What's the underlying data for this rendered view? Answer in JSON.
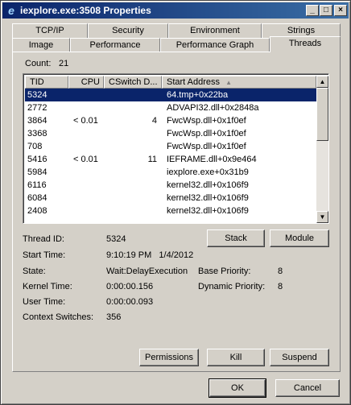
{
  "window": {
    "title": "iexplore.exe:3508 Properties",
    "minimize": "_",
    "maximize": "□",
    "close": "×",
    "icon": "ie-logo-icon",
    "title_bg": "#0a246a"
  },
  "tabs_row1": [
    "TCP/IP",
    "Security",
    "Environment",
    "Strings"
  ],
  "tabs_row2": [
    "Image",
    "Performance",
    "Performance Graph",
    "Threads"
  ],
  "threads": {
    "count_label": "Count:",
    "count_value": "21",
    "columns": [
      "TID",
      "CPU",
      "CSwitch D...",
      "Start Address"
    ],
    "rows": [
      {
        "tid": "5324",
        "cpu": "",
        "cswitch": "",
        "start": "64.tmp+0x22ba"
      },
      {
        "tid": "2772",
        "cpu": "",
        "cswitch": "",
        "start": "ADVAPI32.dll+0x2848a"
      },
      {
        "tid": "3864",
        "cpu": "< 0.01",
        "cswitch": "4",
        "start": "FwcWsp.dll+0x1f0ef"
      },
      {
        "tid": "3368",
        "cpu": "",
        "cswitch": "",
        "start": "FwcWsp.dll+0x1f0ef"
      },
      {
        "tid": "708",
        "cpu": "",
        "cswitch": "",
        "start": "FwcWsp.dll+0x1f0ef"
      },
      {
        "tid": "5416",
        "cpu": "< 0.01",
        "cswitch": "11",
        "start": "IEFRAME.dll+0x9e464"
      },
      {
        "tid": "5984",
        "cpu": "",
        "cswitch": "",
        "start": "iexplore.exe+0x31b9"
      },
      {
        "tid": "6116",
        "cpu": "",
        "cswitch": "",
        "start": "kernel32.dll+0x106f9"
      },
      {
        "tid": "6084",
        "cpu": "",
        "cswitch": "",
        "start": "kernel32.dll+0x106f9"
      },
      {
        "tid": "2408",
        "cpu": "",
        "cswitch": "",
        "start": "kernel32.dll+0x106f9"
      }
    ],
    "selected_tid": "5324",
    "details": {
      "thread_id_label": "Thread ID:",
      "thread_id": "5324",
      "start_time_label": "Start Time:",
      "start_time": "9:10:19 PM   1/4/2012",
      "state_label": "State:",
      "state": "Wait:DelayExecution",
      "base_priority_label": "Base Priority:",
      "base_priority": "8",
      "kernel_time_label": "Kernel Time:",
      "kernel_time": "0:00:00.156",
      "dynamic_priority_label": "Dynamic Priority:",
      "dynamic_priority": "8",
      "user_time_label": "User Time:",
      "user_time": "0:00:00.093",
      "context_switches_label": "Context Switches:",
      "context_switches": "356"
    },
    "buttons": {
      "stack": "Stack",
      "module": "Module",
      "permissions": "Permissions",
      "kill": "Kill",
      "suspend": "Suspend"
    }
  },
  "dialog_buttons": {
    "ok": "OK",
    "cancel": "Cancel"
  },
  "colors": {
    "selection": "#0a246a",
    "face": "#d4d0c8"
  }
}
